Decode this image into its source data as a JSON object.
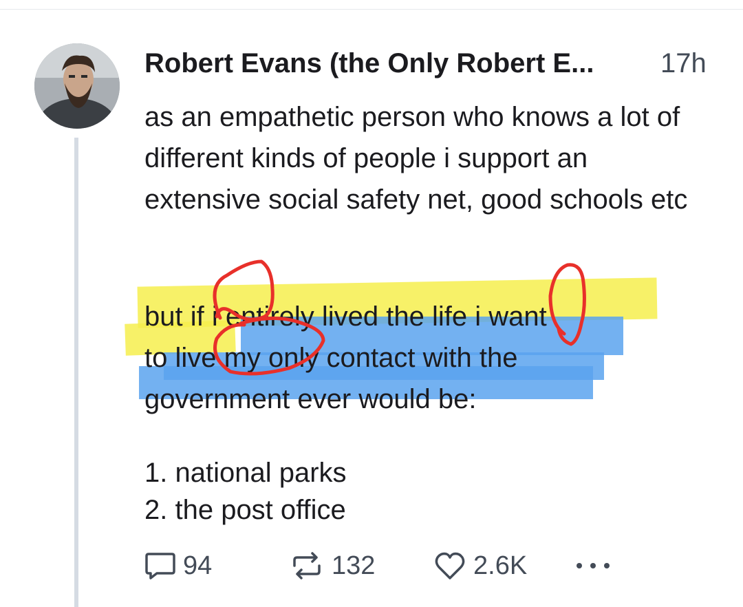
{
  "post": {
    "author": "Robert Evans (the Only Robert E...",
    "timestamp": "17h",
    "paragraph1": "as an empathetic person who knows a lot of different kinds of people i support an extensive social safety net, good schools etc",
    "paragraph2": {
      "line1": "but if i entirely lived the life i want",
      "line2": "to live my only contact with the",
      "line3": "government ever would be:"
    },
    "list": [
      "1. national parks",
      "2. the post office"
    ]
  },
  "actions": {
    "replies": "94",
    "reposts": "132",
    "likes": "2.6K",
    "more_icon": "more-icon"
  },
  "colors": {
    "highlight_yellow": "#f6ef4d",
    "highlight_blue": "#5aa3ef",
    "scribble_red": "#e8302a"
  }
}
